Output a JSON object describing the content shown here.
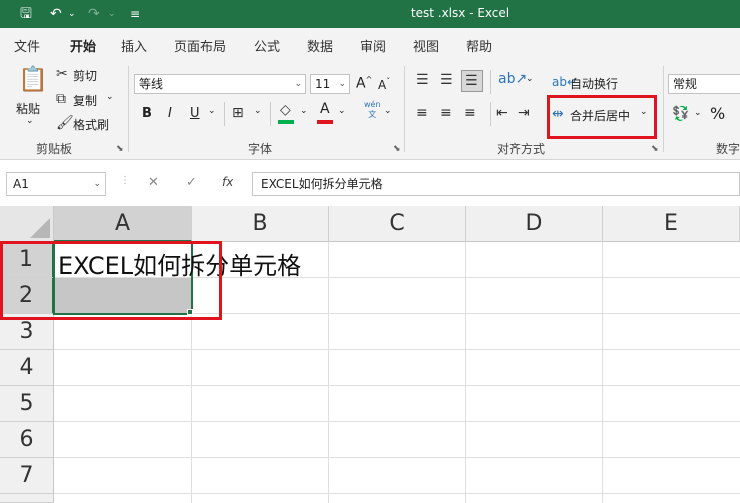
{
  "titlebar": {
    "title": "test .xlsx  -  Excel",
    "save_icon": "save-icon",
    "undo_icon": "undo-icon",
    "redo_icon": "redo-icon",
    "customize_icon": "customize-qat-icon",
    "accent": "#217346"
  },
  "tabs": [
    "文件",
    "开始",
    "插入",
    "页面布局",
    "公式",
    "数据",
    "审阅",
    "视图",
    "帮助"
  ],
  "active_tab": "开始",
  "clipboard": {
    "paste": "粘贴",
    "cut": "剪切",
    "copy": "复制",
    "format_painter": "格式刷",
    "label": "剪贴板"
  },
  "font": {
    "name": "等线",
    "size": "11",
    "grow": "A",
    "shrink": "A",
    "bold": "B",
    "italic": "I",
    "underline": "U",
    "phonetic": "wén\n文",
    "label": "字体",
    "font_color": "#e0141e",
    "fill_color": "#00b050"
  },
  "alignment": {
    "wrap_text": "自动换行",
    "merge_center": "合并后居中",
    "label": "对齐方式"
  },
  "number": {
    "format": "常规",
    "percent": "%",
    "label": "数字"
  },
  "formula_bar": {
    "name_box": "A1",
    "cancel": "✕",
    "enter": "✓",
    "fx": "fx",
    "content": "EXCEL如何拆分单元格"
  },
  "sheet": {
    "columns": [
      "A",
      "B",
      "C",
      "D",
      "E"
    ],
    "rows": [
      "1",
      "2",
      "3",
      "4",
      "5",
      "6",
      "7"
    ],
    "a1": "EXCEL如何拆分单元格"
  },
  "highlight_color": "#e0141e"
}
